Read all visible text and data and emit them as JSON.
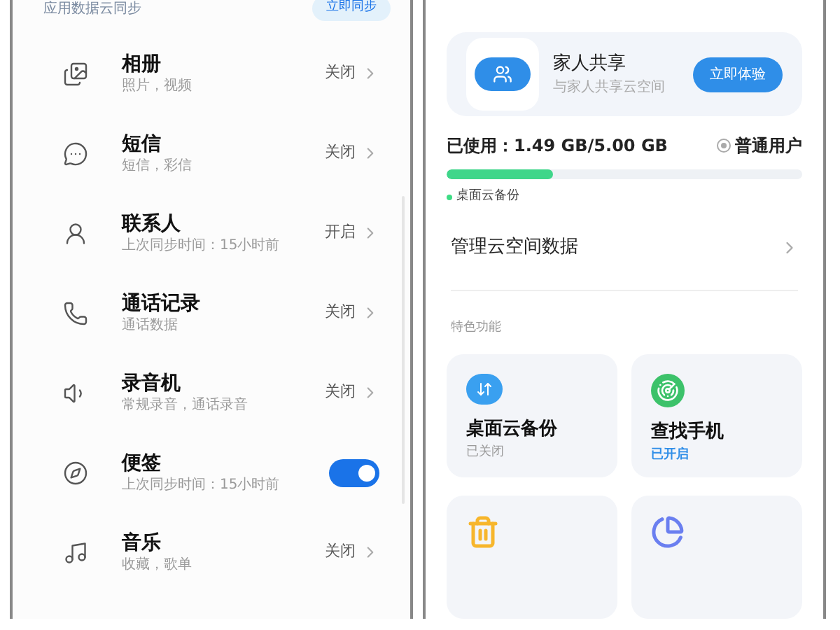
{
  "sync_panel": {
    "section_title": "应用数据云同步",
    "sync_button": "立即同步",
    "items": [
      {
        "kind": "status",
        "title": "相册",
        "subtitle": "照片，视频",
        "status": "关闭"
      },
      {
        "kind": "status",
        "title": "短信",
        "subtitle": "短信，彩信",
        "status": "关闭"
      },
      {
        "kind": "status",
        "title": "联系人",
        "subtitle": "上次同步时间：15小时前",
        "status": "开启"
      },
      {
        "kind": "status",
        "title": "通话记录",
        "subtitle": "通话数据",
        "status": "关闭"
      },
      {
        "kind": "status",
        "title": "录音机",
        "subtitle": "常规录音，通话录音",
        "status": "关闭"
      },
      {
        "kind": "toggle",
        "title": "便签",
        "subtitle": "上次同步时间：15小时前",
        "on": true
      },
      {
        "kind": "status",
        "title": "音乐",
        "subtitle": "收藏，歌单",
        "status": "关闭"
      }
    ]
  },
  "cloud_panel": {
    "family_card": {
      "title": "家人共享",
      "subtitle": "与家人共享云空间",
      "button": "立即体验"
    },
    "storage": {
      "used": "已使用：1.49 GB/5.00 GB",
      "plan": "普通用户",
      "level": 0.3,
      "legend": [
        {
          "label": "桌面云备份",
          "color": "#3ddc84"
        }
      ]
    },
    "manage": "管理云空间数据",
    "features_title": "特色功能",
    "features": [
      {
        "kind": "full",
        "title": "桌面云备份",
        "status": "已关闭",
        "enabled": false
      },
      {
        "kind": "full",
        "title": "查找手机",
        "status": "已开启",
        "enabled": true
      },
      {
        "kind": "cut"
      },
      {
        "kind": "cut"
      }
    ]
  }
}
